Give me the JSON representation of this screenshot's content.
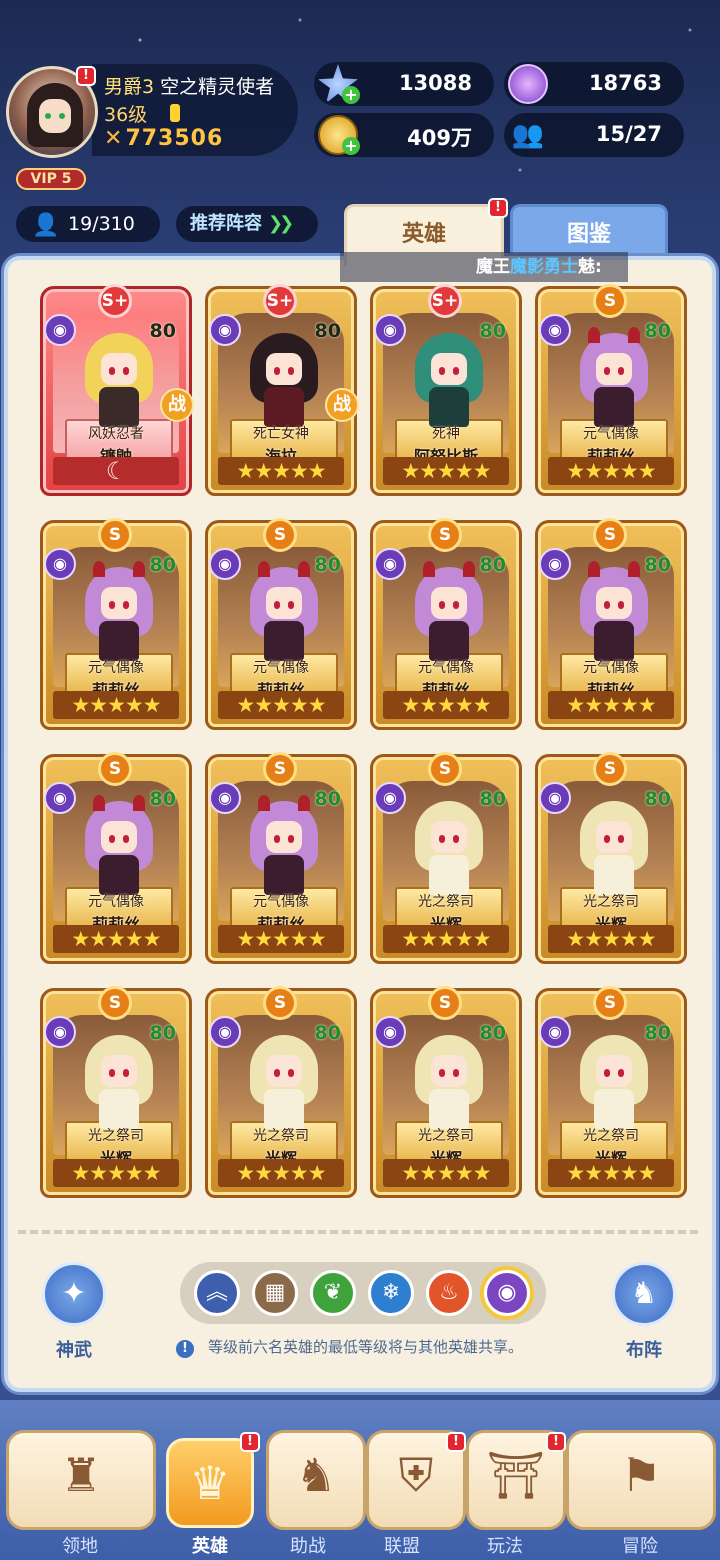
{
  "player": {
    "rank": "男爵3",
    "title": "空之精灵使者",
    "level": "36级",
    "power": "773506",
    "vip": "VIP 5"
  },
  "resources": {
    "gems": "13088",
    "orbs": "18763",
    "gold": "409万",
    "members": "15/27"
  },
  "hero_count": "19/310",
  "recommend_label": "推荐阵容",
  "tabs": {
    "heroes": "英雄",
    "codex": "图鉴"
  },
  "marquee": {
    "prefix": "魔王",
    "highlight": "魔影勇士",
    "suffix": "魅:"
  },
  "heroes": [
    {
      "grade": "S+",
      "level": "80",
      "title": "风妖忍者",
      "name": "镰鼬",
      "stars": "☾",
      "battle": "战",
      "featured": true
    },
    {
      "grade": "S+",
      "level": "80",
      "title": "死亡女神",
      "name": "海拉",
      "stars": "★★★★★",
      "battle": "战"
    },
    {
      "grade": "S+",
      "level": "80",
      "title": "死神",
      "name": "阿努比斯",
      "stars": "★★★★★"
    },
    {
      "grade": "S",
      "level": "80",
      "title": "元气偶像",
      "name": "莉莉丝",
      "stars": "★★★★★"
    },
    {
      "grade": "S",
      "level": "80",
      "title": "元气偶像",
      "name": "莉莉丝",
      "stars": "★★★★★"
    },
    {
      "grade": "S",
      "level": "80",
      "title": "元气偶像",
      "name": "莉莉丝",
      "stars": "★★★★★"
    },
    {
      "grade": "S",
      "level": "80",
      "title": "元气偶像",
      "name": "莉莉丝",
      "stars": "★★★★★"
    },
    {
      "grade": "S",
      "level": "80",
      "title": "元气偶像",
      "name": "莉莉丝",
      "stars": "★★★★★"
    },
    {
      "grade": "S",
      "level": "80",
      "title": "元气偶像",
      "name": "莉莉丝",
      "stars": "★★★★★"
    },
    {
      "grade": "S",
      "level": "80",
      "title": "元气偶像",
      "name": "莉莉丝",
      "stars": "★★★★★"
    },
    {
      "grade": "S",
      "level": "80",
      "title": "光之祭司",
      "name": "光辉",
      "stars": "★★★★★"
    },
    {
      "grade": "S",
      "level": "80",
      "title": "光之祭司",
      "name": "光辉",
      "stars": "★★★★★"
    },
    {
      "grade": "S",
      "level": "80",
      "title": "光之祭司",
      "name": "光辉",
      "stars": "★★★★★"
    },
    {
      "grade": "S",
      "level": "80",
      "title": "光之祭司",
      "name": "光辉",
      "stars": "★★★★★"
    },
    {
      "grade": "S",
      "level": "80",
      "title": "光之祭司",
      "name": "光辉",
      "stars": "★★★★★"
    },
    {
      "grade": "S",
      "level": "80",
      "title": "光之祭司",
      "name": "光辉",
      "stars": "★★★★★"
    }
  ],
  "side_buttons": {
    "weapon": "神武",
    "formation": "布阵"
  },
  "filters": [
    {
      "name": "all",
      "color": "#3e5fae",
      "glyph": "︽"
    },
    {
      "name": "category",
      "color": "#8a6a4a",
      "glyph": "▦"
    },
    {
      "name": "nature",
      "color": "#3fa33c",
      "glyph": "❦"
    },
    {
      "name": "ice",
      "color": "#2f7fd0",
      "glyph": "❄"
    },
    {
      "name": "fire",
      "color": "#e2542a",
      "glyph": "♨"
    },
    {
      "name": "shadow",
      "color": "#7a46c2",
      "glyph": "◉",
      "selected": true
    }
  ],
  "tip": "等级前六名英雄的最低等级将与其他英雄共享。",
  "nav": [
    {
      "label": "领地",
      "icon": "castle-icon",
      "glyph": "♜"
    },
    {
      "label": "英雄",
      "icon": "hero-icon",
      "glyph": "♛",
      "active": true,
      "alert": true
    },
    {
      "label": "助战",
      "icon": "support-icon",
      "glyph": "♞"
    },
    {
      "label": "联盟",
      "icon": "alliance-icon",
      "glyph": "⛨",
      "alert": true
    },
    {
      "label": "玩法",
      "icon": "gate-icon",
      "glyph": "⛩",
      "alert": true
    },
    {
      "label": "冒险",
      "icon": "flag-icon",
      "glyph": "⚑"
    }
  ]
}
